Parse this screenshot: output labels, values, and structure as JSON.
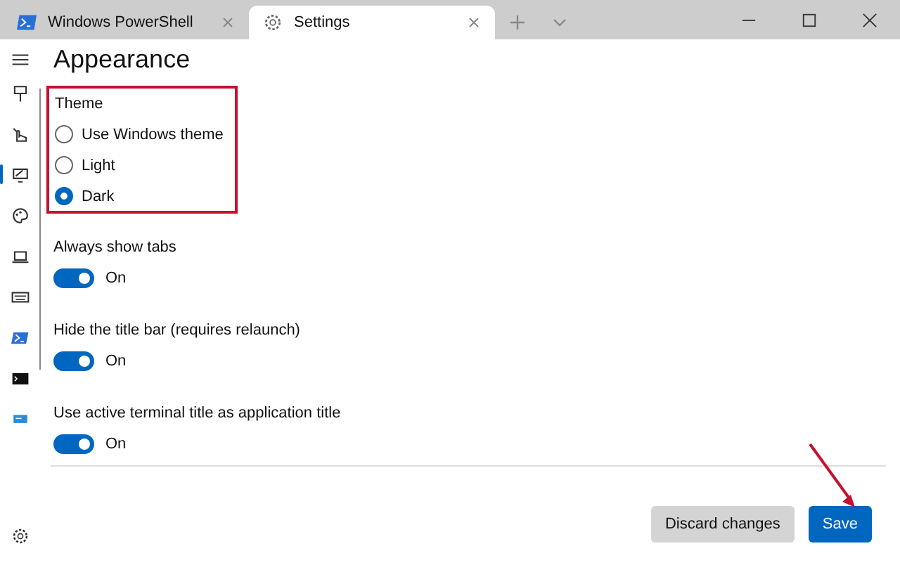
{
  "tabs": [
    {
      "kind": "powershell",
      "label": "Windows PowerShell",
      "selected": false
    },
    {
      "kind": "settings",
      "label": "Settings",
      "selected": true
    }
  ],
  "sidebar": {
    "items": [
      {
        "kind": "startup",
        "selected": false
      },
      {
        "kind": "interaction",
        "selected": false
      },
      {
        "kind": "appearance",
        "selected": true
      },
      {
        "kind": "colors",
        "selected": false
      },
      {
        "kind": "rendering",
        "selected": false
      },
      {
        "kind": "actions",
        "selected": false
      },
      {
        "kind": "powershell",
        "selected": false
      },
      {
        "kind": "cmd",
        "selected": false
      },
      {
        "kind": "azure",
        "selected": false
      }
    ]
  },
  "page": {
    "title": "Appearance",
    "theme": {
      "label": "Theme",
      "options": [
        {
          "label": "Use Windows theme",
          "selected": false
        },
        {
          "label": "Light",
          "selected": false
        },
        {
          "label": "Dark",
          "selected": true
        }
      ]
    },
    "toggles": [
      {
        "label": "Always show tabs",
        "on": true,
        "state": "On"
      },
      {
        "label": "Hide the title bar (requires relaunch)",
        "on": true,
        "state": "On"
      },
      {
        "label": "Use active terminal title as application title",
        "on": true,
        "state": "On"
      }
    ]
  },
  "buttons": [
    {
      "kind": "secondary",
      "label": "Discard changes"
    },
    {
      "kind": "primary",
      "label": "Save"
    }
  ]
}
